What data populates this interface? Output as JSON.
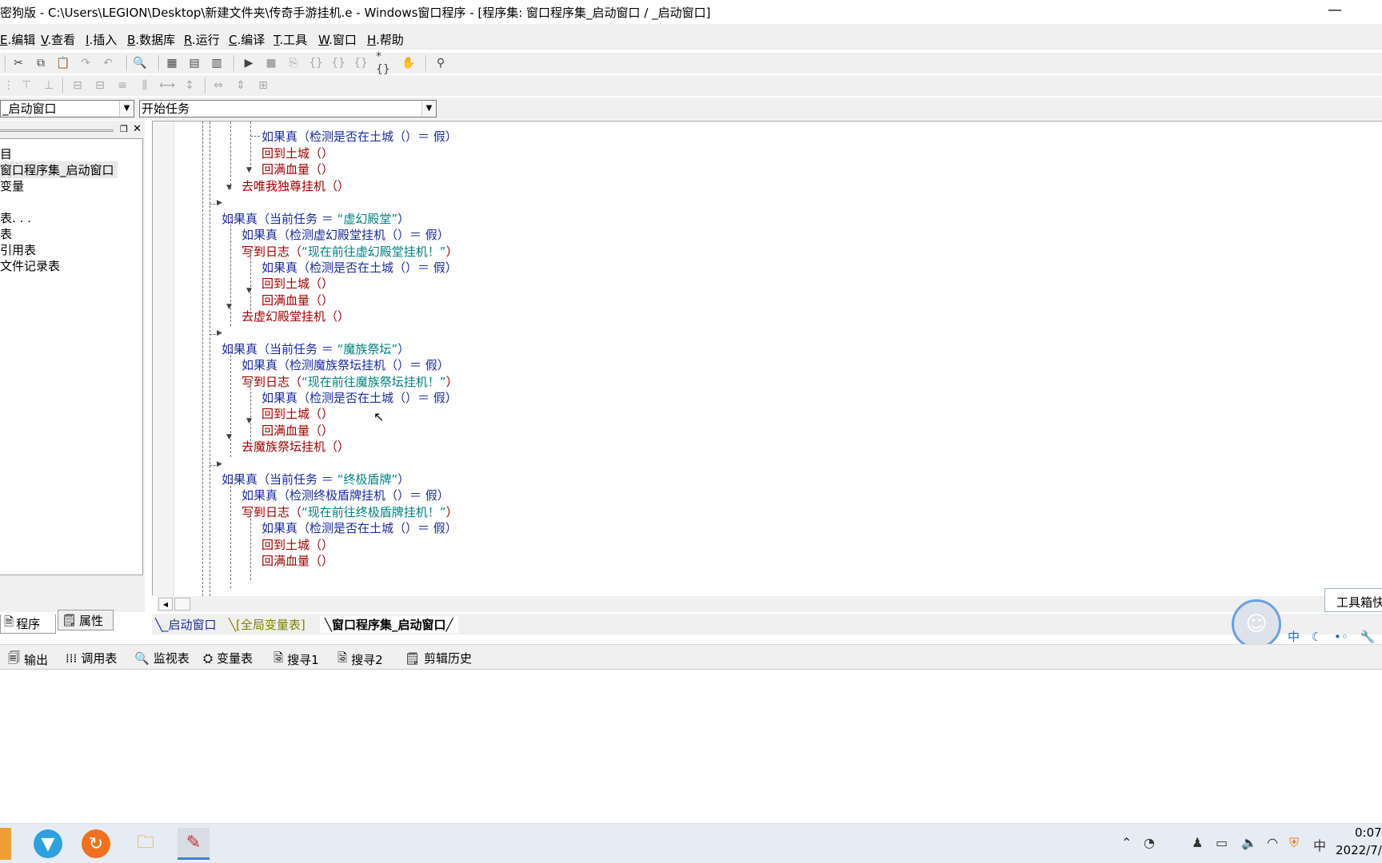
{
  "window": {
    "title": "密狗版 - C:\\Users\\LEGION\\Desktop\\新建文件夹\\传奇手游挂机.e - Windows窗口程序 - [程序集: 窗口程序集_启动窗口 / _启动窗口]",
    "minimize": "—"
  },
  "menu": [
    {
      "key": "E",
      "label": ".编辑"
    },
    {
      "key": "V",
      "label": ".查看"
    },
    {
      "key": "I",
      "label": ".插入"
    },
    {
      "key": "B",
      "label": ".数据库"
    },
    {
      "key": "R",
      "label": ".运行"
    },
    {
      "key": "C",
      "label": ".编译"
    },
    {
      "key": "T",
      "label": ".工具"
    },
    {
      "key": "W",
      "label": ".窗口"
    },
    {
      "key": "H",
      "label": ".帮助"
    }
  ],
  "combos": {
    "object": "_启动窗口",
    "method": "开始任务"
  },
  "tree": {
    "items": [
      "目",
      "窗口程序集_启动窗口",
      "变量",
      "表. . .",
      "表",
      "引用表",
      "文件记录表"
    ]
  },
  "left_tabs": {
    "program": "程序",
    "properties": "属性"
  },
  "code": {
    "lines": [
      {
        "t": [
          [
            "kw",
            "如果真（检测是否在土城（）＝ 假）"
          ]
        ]
      },
      {
        "t": [
          [
            "fn",
            "回到土城（）"
          ]
        ]
      },
      {
        "t": [
          [
            "fn",
            "回满血量（）"
          ]
        ]
      },
      {
        "t": [
          [
            "fn",
            "去唯我独尊挂机（）"
          ]
        ]
      },
      {
        "t": [
          [
            "kw",
            "如果真（当前任务 ＝ "
          ],
          [
            "st",
            "“虚幻殿堂”"
          ],
          [
            "kw",
            "）"
          ]
        ]
      },
      {
        "t": [
          [
            "kw",
            "如果真（检测虚幻殿堂挂机（）＝ 假）"
          ]
        ]
      },
      {
        "t": [
          [
            "fn",
            "写到日志（"
          ],
          [
            "st",
            "“现在前往虚幻殿堂挂机！”"
          ],
          [
            "fn",
            "）"
          ]
        ]
      },
      {
        "t": [
          [
            "kw",
            "如果真（检测是否在土城（）＝ 假）"
          ]
        ]
      },
      {
        "t": [
          [
            "fn",
            "回到土城（）"
          ]
        ]
      },
      {
        "t": [
          [
            "fn",
            "回满血量（）"
          ]
        ]
      },
      {
        "t": [
          [
            "fn",
            "去虚幻殿堂挂机（）"
          ]
        ]
      },
      {
        "t": [
          [
            "kw",
            "如果真（当前任务 ＝ "
          ],
          [
            "st",
            "“魔族祭坛”"
          ],
          [
            "kw",
            "）"
          ]
        ]
      },
      {
        "t": [
          [
            "kw",
            "如果真（检测魔族祭坛挂机（）＝ 假）"
          ]
        ]
      },
      {
        "t": [
          [
            "fn",
            "写到日志（"
          ],
          [
            "st",
            "“现在前往魔族祭坛挂机！”"
          ],
          [
            "fn",
            "）"
          ]
        ]
      },
      {
        "t": [
          [
            "kw",
            "如果真（检测是否在土城（）＝ 假）"
          ]
        ]
      },
      {
        "t": [
          [
            "fn",
            "回到土城（）"
          ]
        ]
      },
      {
        "t": [
          [
            "fn",
            "回满血量（）"
          ]
        ]
      },
      {
        "t": [
          [
            "fn",
            "去魔族祭坛挂机（）"
          ]
        ]
      },
      {
        "t": [
          [
            "kw",
            "如果真（当前任务 ＝ "
          ],
          [
            "st",
            "“终极盾牌”"
          ],
          [
            "kw",
            "）"
          ]
        ]
      },
      {
        "t": [
          [
            "kw",
            "如果真（检测终极盾牌挂机（）＝ 假）"
          ]
        ]
      },
      {
        "t": [
          [
            "fn",
            "写到日志（"
          ],
          [
            "st",
            "“现在前往终极盾牌挂机！”"
          ],
          [
            "fn",
            "）"
          ]
        ]
      },
      {
        "t": [
          [
            "kw",
            "如果真（检测是否在土城（）＝ 假）"
          ]
        ]
      },
      {
        "t": [
          [
            "fn",
            "回到土城（）"
          ]
        ]
      },
      {
        "t": [
          [
            "fn",
            "回满血量（）"
          ]
        ]
      }
    ]
  },
  "doc_tabs": [
    "_启动窗口",
    "[全局变量表]",
    "窗口程序集_启动窗口"
  ],
  "bottom_tabs": [
    "输出",
    "调用表",
    "监视表",
    "变量表",
    "搜寻1",
    "搜寻2",
    "剪辑历史"
  ],
  "toolbox": {
    "label": "工具箱快"
  },
  "ime": {
    "lang": "中"
  },
  "clock": {
    "time": "0:07",
    "date": "2022/7/"
  },
  "tray": {
    "lang": "中"
  }
}
